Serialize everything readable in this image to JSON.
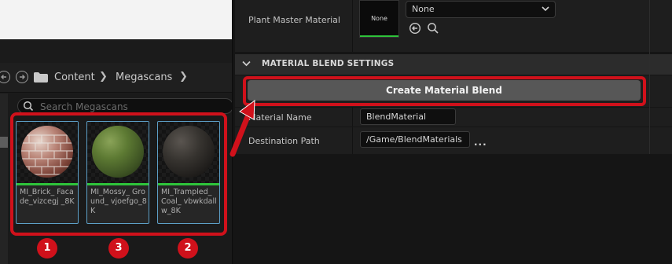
{
  "content_browser": {
    "breadcrumb": [
      "Content",
      "Megascans"
    ],
    "search_placeholder": "Search Megascans",
    "assets": [
      {
        "label": "MI_Brick_ Facade_vizcegj _8K",
        "badge": "1"
      },
      {
        "label": "MI_Mossy_ Ground_ vjoefgo_8K",
        "badge": "3"
      },
      {
        "label": "MI_Trampled_ Coal_ vbwkdallw_8K",
        "badge": "2"
      }
    ]
  },
  "details": {
    "plant_master_label": "Plant Master Material",
    "plant_master_thumb": "None",
    "plant_master_value": "None",
    "section_title": "MATERIAL BLEND SETTINGS",
    "create_button": "Create Material Blend",
    "material_name_label": "Material Name",
    "material_name_value": "BlendMaterial",
    "destination_label": "Destination Path",
    "destination_value": "/Game/BlendMaterials",
    "more": "..."
  },
  "colors": {
    "highlight": "#d0111b",
    "selection": "#5da0c8",
    "green": "#2ec43a"
  }
}
